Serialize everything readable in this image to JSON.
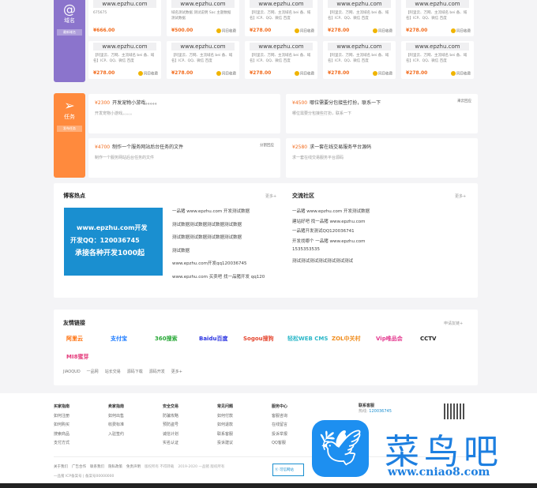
{
  "domain_section": {
    "icon": "@",
    "title": "域名",
    "tag": "最新域名",
    "cards": [
      {
        "name": "www.epzhu.com",
        "desc": "675675",
        "price": "¥666.00",
        "badge": ""
      },
      {
        "name": "www.epzhu.com",
        "desc": "域名测试数据 测试说明 Sac 主题数据 测试数据",
        "price": "¥500.00",
        "badge": "同日收费"
      },
      {
        "name": "www.epzhu.com",
        "desc": "【阿里云、万网、主流域名 bei 备、域名】ICP、QQ、微信 百度",
        "price": "¥278.00",
        "badge": "同日收费"
      },
      {
        "name": "www.epzhu.com",
        "desc": "【阿里云、万网、主流域名 bei 备、域名】ICP、QQ、微信 百度",
        "price": "¥278.00",
        "badge": "同日收费"
      },
      {
        "name": "www.epzhu.com",
        "desc": "【阿里云、万网、主流域名 bei 备、域名】ICP、QQ、微信 百度",
        "price": "¥278.00",
        "badge": "同日收费"
      },
      {
        "name": "www.epzhu.com",
        "desc": "【阿里云、万网、主流域名 bei 备、域名】ICP、QQ、微信 百度",
        "price": "¥278.00",
        "badge": "同日收费"
      },
      {
        "name": "www.epzhu.com",
        "desc": "【阿里云、万网、主流域名 bei 备、域名】ICP、QQ、微信 百度",
        "price": "¥278.00",
        "badge": "同日收费"
      },
      {
        "name": "www.epzhu.com",
        "desc": "【阿里云、万网、主流域名 bei 备、域名】ICP、QQ、微信 百度",
        "price": "¥278.00",
        "badge": "同日收费"
      },
      {
        "name": "www.epzhu.com",
        "desc": "【阿里云、万网、主流域名 bei 备、域名】ICP、QQ、微信 百度",
        "price": "¥278.00",
        "badge": "同日收费"
      },
      {
        "name": "www.epzhu.com",
        "desc": "【阿里云、万网、主流域名 bei 备、域名】ICP、QQ、微信 百度",
        "price": "¥278.00",
        "badge": "同日收费"
      }
    ]
  },
  "task_section": {
    "title": "任务",
    "tag": "发布任务",
    "cards": [
      {
        "price": "¥2300",
        "title": "开发宠物小游戏。。。。。",
        "desc": "开发宠物小游戏。。。。。",
        "user": ""
      },
      {
        "price": "¥4500",
        "title": "哪位需要分包接些打扮，联系一下",
        "desc": "哪位需要分包接些打扮，联系一下",
        "user": "来云回应"
      },
      {
        "price": "¥4700",
        "title": "制作一个服务网站后台任务的文件",
        "desc": "制作一个服务网站后台任务的文件",
        "user": "分割回应"
      },
      {
        "price": "¥2580",
        "title": "求一套在线交易服务平台源码",
        "desc": "求一套在线交易服务平台源码",
        "user": ""
      }
    ]
  },
  "blog": {
    "title": "博客热点",
    "more": "更多+",
    "banner": [
      "www.epzhu.com开发",
      "开发QQ：120036745",
      "承接各种开发1000起"
    ],
    "items": [
      "一品猪 www.epzhu.com 开发测试数据",
      "测试数据测试数据测试数据测试数据",
      "测试数据测试数据测试数据测试数据",
      "测试数据",
      "www.epzhu.com开发qq120036745",
      "www.epzhu.com 买卖吧 找一品猪开发 qq120"
    ]
  },
  "community": {
    "title": "交流社区",
    "more": "更多+",
    "items": [
      "一品猪 www.epzhu.com 开发测试数据",
      "建站好吧 找一品猪 www.epzhu.com",
      "一品猪开发测试QQ120036741",
      "开发找哪个 一品猪 www.epzhu.com",
      "1535353535",
      "测试测试测试测试测试测试测试"
    ]
  },
  "links": {
    "title": "友情链接",
    "apply": "申请友链+",
    "logos": [
      {
        "text": "阿里云",
        "color": "#ff6a00"
      },
      {
        "text": "支付宝",
        "color": "#1677ff"
      },
      {
        "text": "360搜索",
        "color": "#27a836"
      },
      {
        "text": "Baidu百度",
        "color": "#2932e1"
      },
      {
        "text": "Sogou搜狗",
        "color": "#e5452e"
      },
      {
        "text": "轻松WEB CMS",
        "color": "#2bb7c8"
      },
      {
        "text": "ZOL中关村",
        "color": "#f08c1c"
      },
      {
        "text": "Vip唯品会",
        "color": "#e4398f"
      },
      {
        "text": "CCTV",
        "color": "#222222"
      },
      {
        "text": "MI8蜜芽",
        "color": "#e4397a"
      }
    ],
    "text_links": [
      "JIAOQUD",
      "一品网",
      "站长交易",
      "源码下载",
      "源码开发",
      "更多+"
    ]
  },
  "footer": {
    "columns": [
      {
        "title": "买家指南",
        "items": [
          "如何注册",
          "如何购买",
          "搜索商品",
          "支付方式"
        ]
      },
      {
        "title": "卖家指南",
        "items": [
          "如何出售",
          "收费标准",
          "入驻签约"
        ]
      },
      {
        "title": "安全交易",
        "items": [
          "防骗攻略",
          "预防盗号",
          "诚信计划",
          "实名认证"
        ]
      },
      {
        "title": "常见问题",
        "items": [
          "如何付款",
          "如何退款",
          "联系客服",
          "投诉建议"
        ]
      },
      {
        "title": "服务中心",
        "items": [
          "客服咨询",
          "在线留言",
          "投诉举报",
          "QQ客服"
        ]
      }
    ],
    "service": {
      "title": "联系客服",
      "label": "热线:",
      "phone": "120036745"
    },
    "bottom_links": [
      "关于我们",
      "广告合作",
      "联系我们",
      "隐私政策",
      "免责声明",
      "版权所有 不得转载",
      "2019-2020 一品猪 版权所有"
    ],
    "copyright": "一品猪 ICP备案号 | 备案号00000000",
    "badge": "可信网站"
  },
  "watermark": {
    "cn": "菜鸟吧",
    "url": "www.cniao8.com"
  },
  "colors": {
    "purple": "#8b74cc",
    "orange": "#ff8a3d",
    "price": "#f26a1b",
    "blue": "#1a8fd0"
  }
}
